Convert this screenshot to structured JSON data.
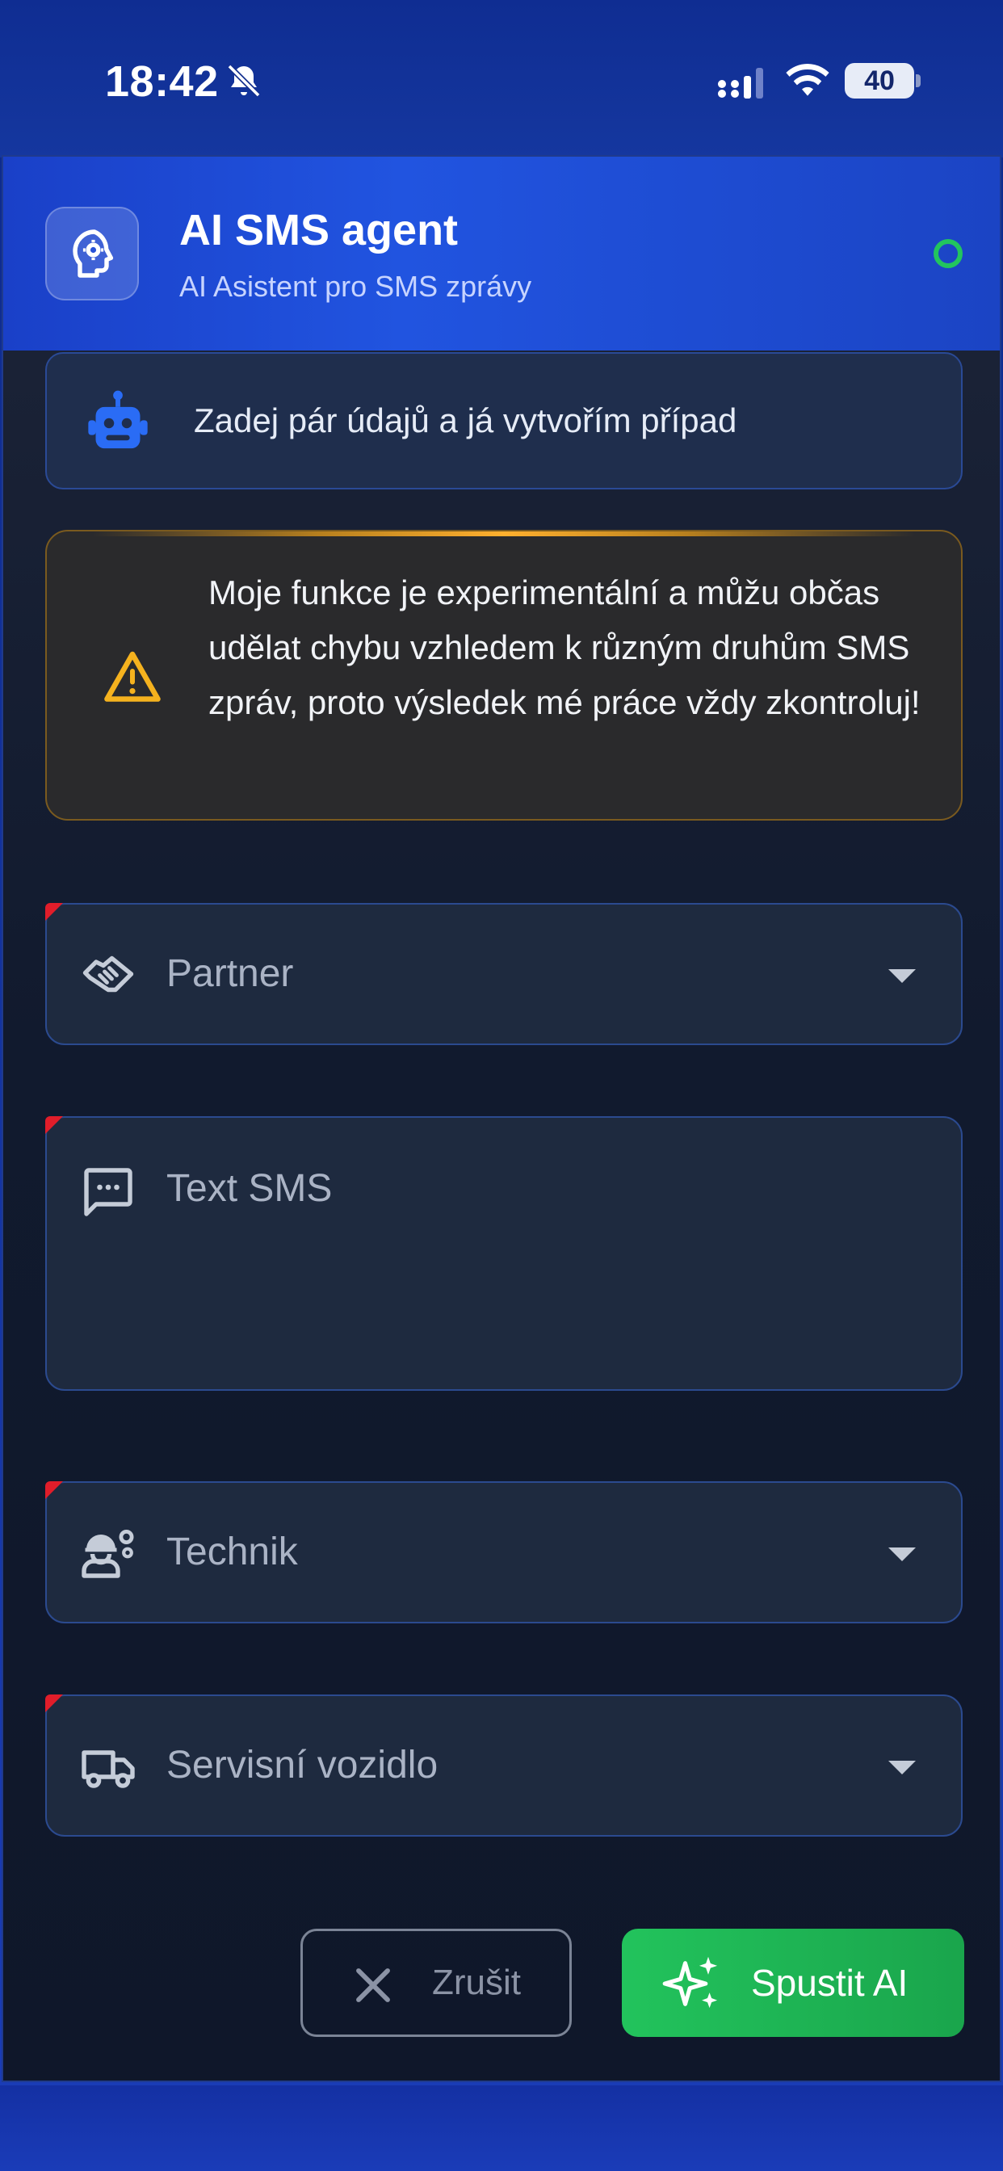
{
  "status_bar": {
    "time": "18:42",
    "battery": "40",
    "icons": [
      "bell-slash-icon",
      "signal-icon",
      "wifi-icon",
      "battery-icon"
    ]
  },
  "header": {
    "title": "AI SMS agent",
    "subtitle": "AI Asistent pro SMS zprávy",
    "icon": "ai-head-gear-icon",
    "status_color": "#22c55e"
  },
  "bot_card": {
    "icon": "robot-icon",
    "text": "Zadej pár údajů a já vytvořím případ"
  },
  "warning": {
    "icon": "warning-triangle-icon",
    "text": "Moje funkce je experimentální a můžu občas udělat chybu vzhledem k různým druhům SMS zpráv, proto výsledek mé práce vždy zkontroluj!"
  },
  "fields": {
    "partner": {
      "placeholder": "Partner",
      "icon": "handshake-icon"
    },
    "sms_text": {
      "placeholder": "Text SMS",
      "icon": "message-icon"
    },
    "technik": {
      "placeholder": "Technik",
      "icon": "engineer-icon"
    },
    "vehicle": {
      "placeholder": "Servisní vozidlo",
      "icon": "truck-icon"
    }
  },
  "actions": {
    "cancel_label": "Zrušit",
    "run_label": "Spustit AI"
  },
  "colors": {
    "accent": "#2154e0",
    "success": "#22c35c",
    "required_marker": "#e11d2a",
    "warning": "#f5b21e"
  }
}
